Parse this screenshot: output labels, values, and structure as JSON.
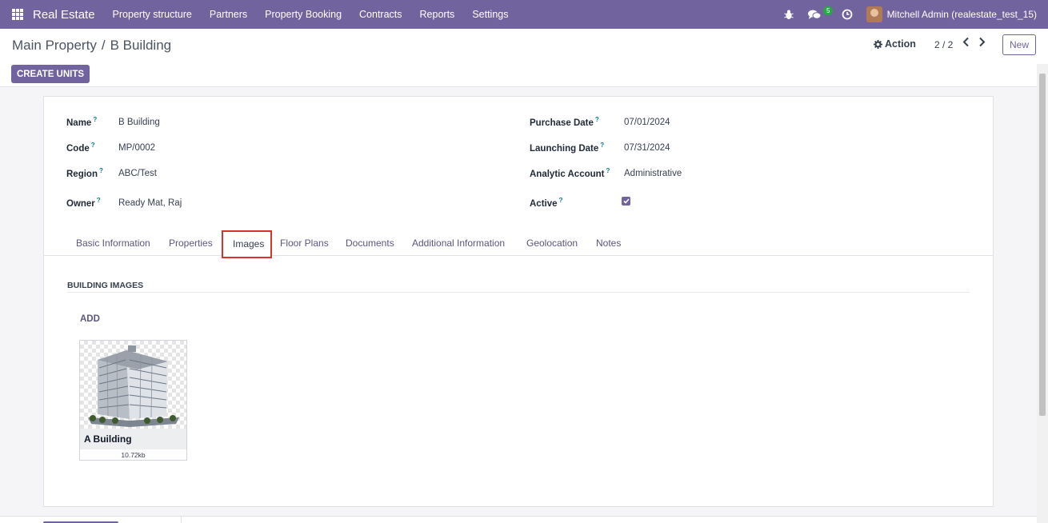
{
  "navbar": {
    "brand": "Real Estate",
    "menu": [
      "Property structure",
      "Partners",
      "Property Booking",
      "Contracts",
      "Reports",
      "Settings"
    ],
    "message_count": "5",
    "user": "Mitchell Admin (realestate_test_15)",
    "icons": [
      "apps-icon",
      "bug-icon",
      "chat-icon",
      "clock-icon"
    ]
  },
  "control": {
    "breadcrumb_parent": "Main Property",
    "breadcrumb_sep": "/",
    "breadcrumb_current": "B Building",
    "action_label": "Action",
    "pager": "2 / 2",
    "new_label": "New",
    "create_units_label": "CREATE UNITS"
  },
  "form": {
    "left": [
      {
        "label": "Name",
        "value": "B Building"
      },
      {
        "label": "Code",
        "value": "MP/0002"
      },
      {
        "label": "Region",
        "value": "ABC/Test"
      },
      {
        "label": "Owner",
        "value": "Ready Mat, Raj"
      }
    ],
    "right": [
      {
        "label": "Purchase Date",
        "value": "07/01/2024"
      },
      {
        "label": "Launching Date",
        "value": "07/31/2024"
      },
      {
        "label": "Analytic Account",
        "value": "Administrative"
      },
      {
        "label": "Active",
        "value": ""
      }
    ],
    "help_mark": "?",
    "active_checked": true
  },
  "tabs": [
    "Basic Information",
    "Properties",
    "Images",
    "Floor Plans",
    "Documents",
    "Additional Information",
    "Geolocation",
    "Notes"
  ],
  "active_tab": "Images",
  "images_section": {
    "title": "BUILDING IMAGES",
    "add_label": "ADD",
    "items": [
      {
        "name": "A Building",
        "size": "10.72kb"
      }
    ]
  },
  "colors": {
    "brand": "#71639e",
    "active_tab_highlight": "#d9312b",
    "badge": "#28a745"
  }
}
